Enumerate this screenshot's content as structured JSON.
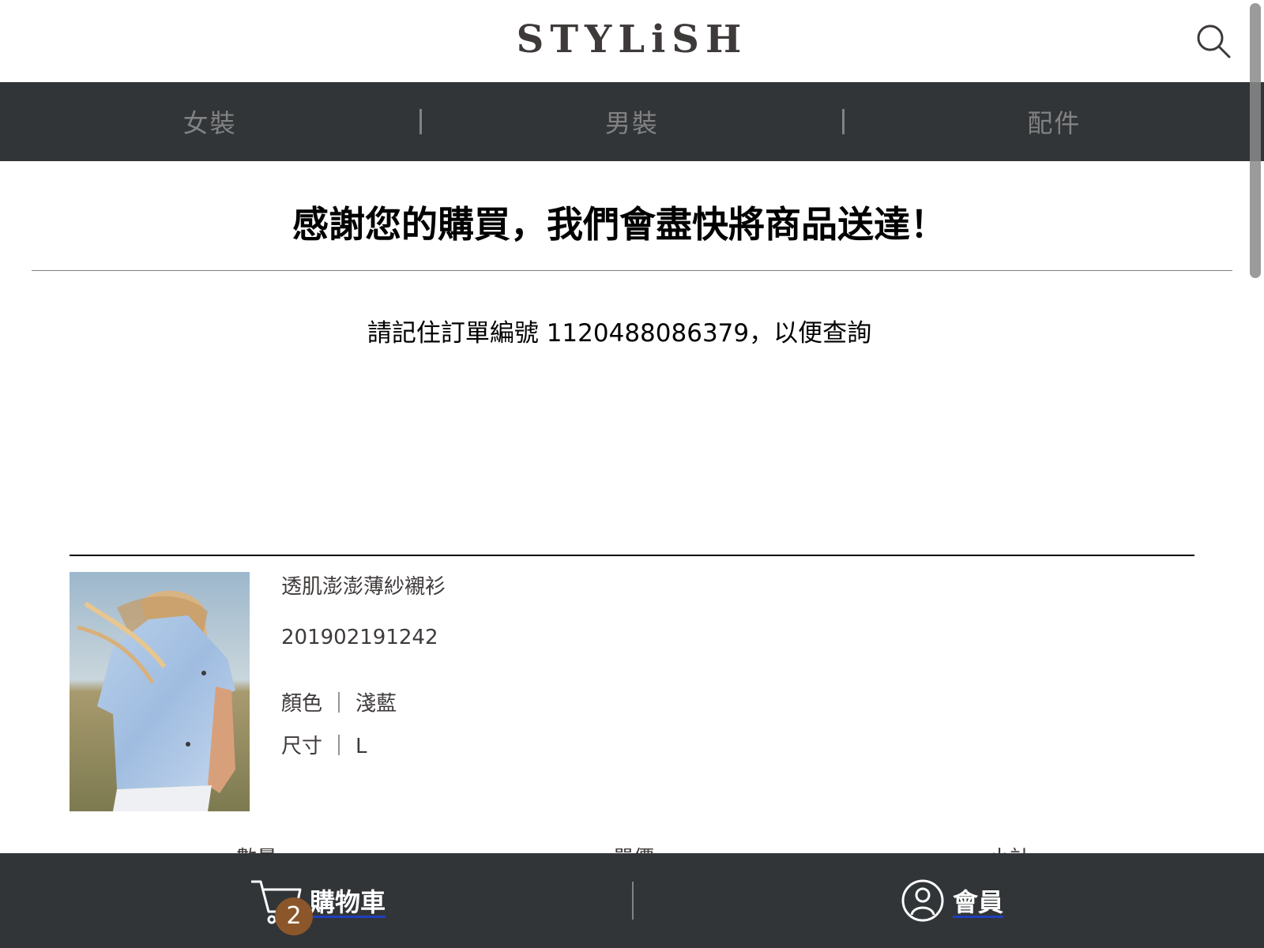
{
  "header": {
    "logo": "STYLiSH",
    "search_icon": "search-icon"
  },
  "categories": [
    "女裝",
    "男裝",
    "配件"
  ],
  "thanks": {
    "title": "感謝您的購買，我們會盡快將商品送達！",
    "order_note": "請記住訂單編號 1120488086379，以便查詢"
  },
  "item": {
    "name": "透肌澎澎薄紗襯衫",
    "id": "201902191242",
    "color_label": "顏色",
    "color_value": "淺藍",
    "size_label": "尺寸",
    "size_value": "L",
    "separator": "｜"
  },
  "columns": [
    "數量",
    "單價",
    "小計"
  ],
  "bottom_bar": {
    "cart_label": "購物車",
    "cart_count": "2",
    "member_label": "會員"
  },
  "colors": {
    "nav_bg": "#313538",
    "nav_text": "#828282",
    "badge": "#8b572a"
  }
}
